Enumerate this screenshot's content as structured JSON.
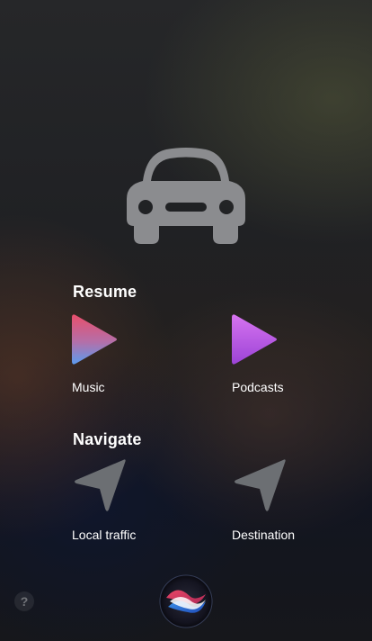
{
  "car": {
    "icon": "car-icon"
  },
  "resume": {
    "title": "Resume",
    "music": {
      "label": "Music",
      "icon": "play-gradient-icon",
      "colors": [
        "#e84f6c",
        "#5b9cf0"
      ]
    },
    "podcasts": {
      "label": "Podcasts",
      "icon": "play-purple-icon",
      "colors": [
        "#d774f0",
        "#9b43d6"
      ]
    }
  },
  "navigate": {
    "title": "Navigate",
    "local_traffic": {
      "label": "Local traffic",
      "icon": "location-arrow-icon"
    },
    "destination": {
      "label": "Destination",
      "icon": "location-arrow-icon"
    }
  },
  "footer": {
    "help_label": "?",
    "siri": {
      "icon": "siri-orb-icon"
    }
  }
}
